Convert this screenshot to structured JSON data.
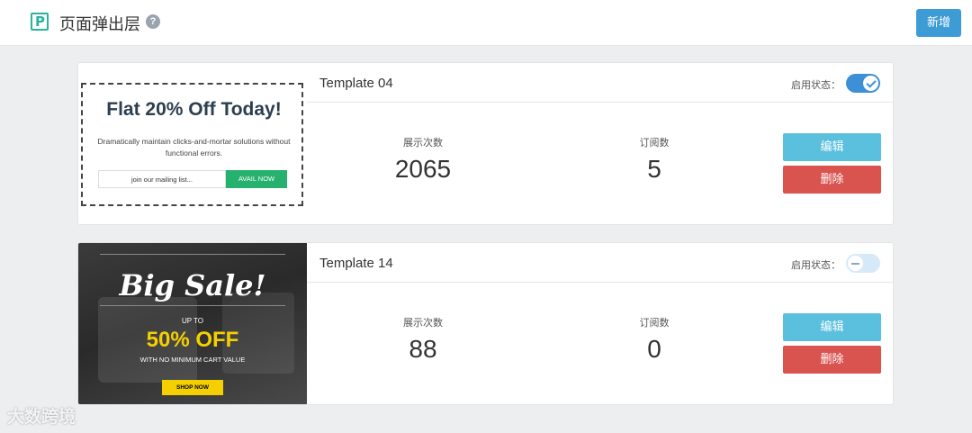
{
  "header": {
    "title": "页面弹出层",
    "help_icon": "?",
    "add_button": "新增"
  },
  "templates": [
    {
      "name": "Template 04",
      "status_label": "启用状态：",
      "enabled": true,
      "views_label": "展示次数",
      "views": "2065",
      "subs_label": "订阅数",
      "subs": "5",
      "edit_label": "编辑",
      "delete_label": "删除",
      "preview": {
        "headline": "Flat 20% Off Today!",
        "body": "Dramatically maintain clicks-and-mortar solutions without functional errors.",
        "email_placeholder": "join our mailing list...",
        "cta": "AVAIL NOW"
      }
    },
    {
      "name": "Template 14",
      "status_label": "启用状态：",
      "enabled": false,
      "views_label": "展示次数",
      "views": "88",
      "subs_label": "订阅数",
      "subs": "0",
      "edit_label": "编辑",
      "delete_label": "删除",
      "preview": {
        "headline": "Big Sale!",
        "upto": "UP TO",
        "percent": "50% OFF",
        "subline": "WITH NO MINIMUM CART VALUE",
        "cta": "SHOP NOW"
      }
    }
  ],
  "watermark": "大数跨境",
  "colors": {
    "brand": "#2bb39b",
    "primary": "#3d9bd6",
    "edit": "#5bc0de",
    "delete": "#d9534f",
    "sale_yellow": "#f5d000"
  }
}
